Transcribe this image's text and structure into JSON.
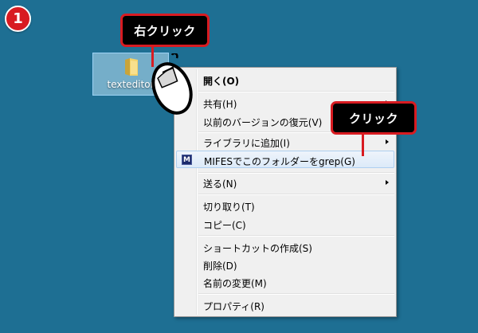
{
  "step_number": "1",
  "callouts": {
    "right_click": "右クリック",
    "click": "クリック"
  },
  "desktop_folder": {
    "label": "texteditor",
    "icon": "folder-icon"
  },
  "context_menu": {
    "items": [
      {
        "label": "開く(O)",
        "bold": true,
        "has_arrow": false
      },
      {
        "label": "共有(H)",
        "bold": false,
        "has_arrow": true
      },
      {
        "label": "以前のバージョンの復元(V)",
        "bold": false,
        "has_arrow": false
      },
      {
        "label": "ライブラリに追加(I)",
        "bold": false,
        "has_arrow": true
      },
      {
        "label": "MIFESでこのフォルダーをgrep(G)",
        "bold": false,
        "has_arrow": false,
        "highlighted": true,
        "icon": "mifes-icon",
        "icon_text": "M"
      },
      {
        "label": "送る(N)",
        "bold": false,
        "has_arrow": true
      },
      {
        "label": "切り取り(T)",
        "bold": false,
        "has_arrow": false
      },
      {
        "label": "コピー(C)",
        "bold": false,
        "has_arrow": false
      },
      {
        "label": "ショートカットの作成(S)",
        "bold": false,
        "has_arrow": false
      },
      {
        "label": "削除(D)",
        "bold": false,
        "has_arrow": false
      },
      {
        "label": "名前の変更(M)",
        "bold": false,
        "has_arrow": false
      },
      {
        "label": "プロパティ(R)",
        "bold": false,
        "has_arrow": false
      }
    ]
  },
  "colors": {
    "desktop_background": "#1e6f93",
    "callout_border": "#d81b21",
    "badge": "#d81b21"
  }
}
